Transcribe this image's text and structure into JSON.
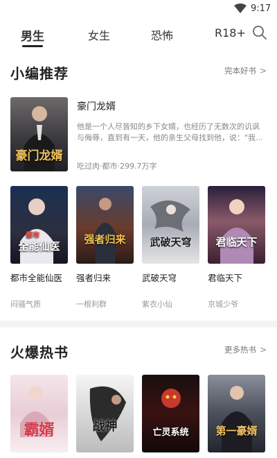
{
  "status_bar": {
    "time": "9:17"
  },
  "tabs": [
    {
      "label": "男生"
    },
    {
      "label": "女生"
    },
    {
      "label": "恐怖"
    },
    {
      "label": "R18+"
    }
  ],
  "section1": {
    "title": "小编推荐",
    "more": "完本好书",
    "featured": {
      "title": "豪门龙婿",
      "cover_text": "豪门龙婿",
      "description": "他是一个人尽皆知的乡下女婿，也经历了无数次的讥讽与侮辱，直到有一天，他的亲生父母找到他，说：\"我...",
      "meta": "吃过肉·都市·299.7万字"
    },
    "books": [
      {
        "title": "都市全能仙医",
        "author": "闷骚气质",
        "cover_text": "全能仙医",
        "cover_small": "都市"
      },
      {
        "title": "强者归来",
        "author": "一根利群",
        "cover_text": "强者归来"
      },
      {
        "title": "武破天穹",
        "author": "紫衣小仙",
        "cover_text": "武破天穹"
      },
      {
        "title": "君临天下",
        "author": "京城少爷",
        "cover_text": "君临天下"
      }
    ]
  },
  "section2": {
    "title": "火爆热书",
    "more": "更多热书",
    "books": [
      {
        "cover_text": "霸婿"
      },
      {
        "cover_text": "战神"
      },
      {
        "cover_text": "亡灵系统"
      },
      {
        "cover_text": "第一豪婿"
      }
    ]
  },
  "colors": {
    "accent": "#222222",
    "muted": "#888888",
    "divider": "#f3f3f3"
  }
}
